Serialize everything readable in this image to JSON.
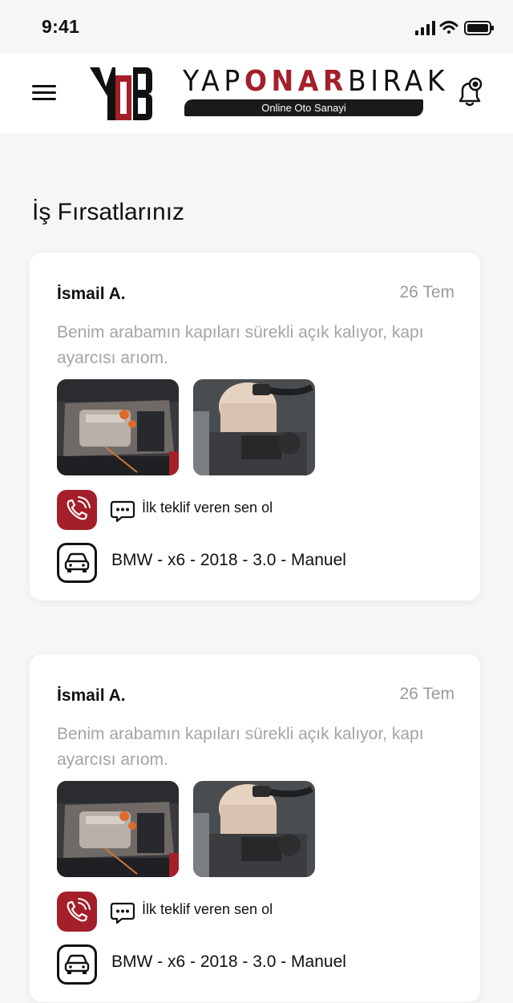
{
  "status_bar": {
    "time": "9:41"
  },
  "header": {
    "logo_mark_text": "YOB",
    "brand_part1": "YAP",
    "brand_part2": "ONAR",
    "brand_part3": "BIRAK",
    "brand_tagline": "Online Oto Sanayi",
    "accent_color": "#a51f2a"
  },
  "page": {
    "title": "İş Fırsatlarınız"
  },
  "cards": [
    {
      "name": "İsmail A.",
      "date": "26 Tem",
      "description": "Benim arabamın kapıları sürekli açık kalıyor, kapı ayarcısı arıom.",
      "images": [
        "engine-photo",
        "coolant-reservoir-photo"
      ],
      "offer_text": "İlk teklif veren sen ol",
      "vehicle": "BMW - x6 - 2018 - 3.0 - Manuel"
    },
    {
      "name": "İsmail A.",
      "date": "26 Tem",
      "description": "Benim arabamın kapıları sürekli açık kalıyor, kapı ayarcısı arıom.",
      "images": [
        "engine-photo",
        "coolant-reservoir-photo"
      ],
      "offer_text": "İlk teklif veren sen ol",
      "vehicle": "BMW - x6 - 2018 - 3.0 - Manuel"
    }
  ]
}
